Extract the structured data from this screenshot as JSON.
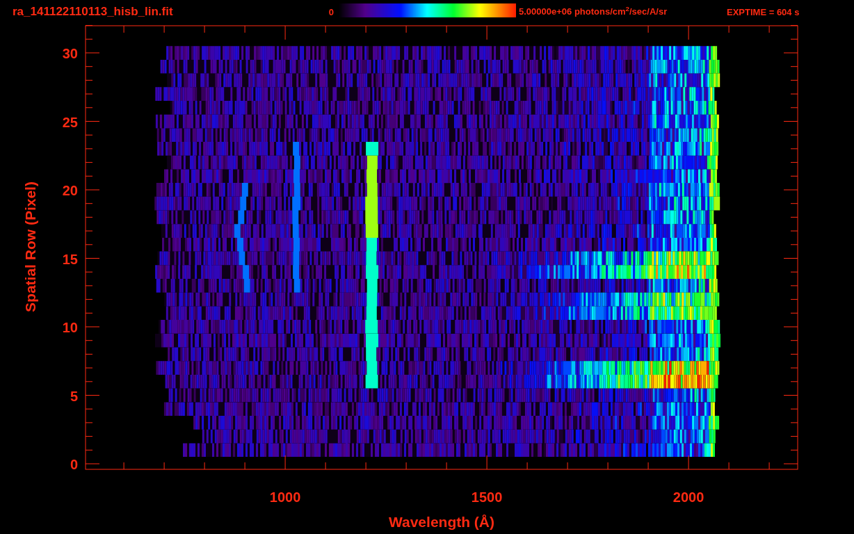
{
  "plot": {
    "title": "ra_141122110113_hisb_lin.fit",
    "colorbar": {
      "min_label": "0",
      "max_label": "5.00000e+06 photons/cm$^{2}$/sec/A/sr"
    },
    "exptime": "EXPTIME = 604 s",
    "xlabel": "Wavelength (Å)",
    "ylabel": "Spatial Row (Pixel)",
    "yticks": [
      "30",
      "25",
      "20",
      "15",
      "10",
      "5",
      "0"
    ],
    "xticks": [
      "1000",
      "1500",
      "2000"
    ]
  }
}
